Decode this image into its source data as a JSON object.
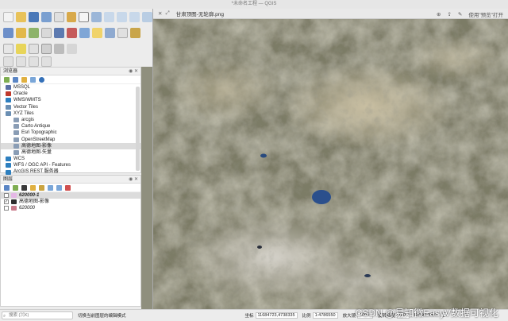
{
  "window": {
    "title": "*未命名工程 — QGIS"
  },
  "browser_panel": {
    "title": "浏览器",
    "items": [
      {
        "label": "MSSQL",
        "icon": "mssql-icon",
        "indent": 0,
        "color": "#5a6fa5"
      },
      {
        "label": "Oracle",
        "icon": "oracle-icon",
        "indent": 0,
        "color": "#c0392b"
      },
      {
        "label": "WMS/WMTS",
        "icon": "wms-icon",
        "indent": 0,
        "color": "#2d7fbf"
      },
      {
        "label": "Vector Tiles",
        "icon": "vector-tiles-icon",
        "indent": 0,
        "color": "#6b8fb3"
      },
      {
        "label": "XYZ Tiles",
        "icon": "xyz-tiles-icon",
        "indent": 0,
        "color": "#6b8fb3"
      },
      {
        "label": "arcgis",
        "icon": "tile-icon",
        "indent": 1,
        "color": "#8a9db5"
      },
      {
        "label": "Carto Antique",
        "icon": "tile-icon",
        "indent": 1,
        "color": "#8a9db5"
      },
      {
        "label": "Esri Topographic",
        "icon": "tile-icon",
        "indent": 1,
        "color": "#8a9db5"
      },
      {
        "label": "OpenStreetMap",
        "icon": "tile-icon",
        "indent": 1,
        "color": "#8a9db5"
      },
      {
        "label": "高德地图-影像",
        "icon": "tile-icon",
        "indent": 1,
        "color": "#8a9db5",
        "selected": true
      },
      {
        "label": "高德地图-矢量",
        "icon": "tile-icon",
        "indent": 1,
        "color": "#8a9db5"
      },
      {
        "label": "WCS",
        "icon": "wcs-icon",
        "indent": 0,
        "color": "#2d7fbf"
      },
      {
        "label": "WFS / OGC API - Features",
        "icon": "wfs-icon",
        "indent": 0,
        "color": "#2d7fbf"
      },
      {
        "label": "ArcGIS REST 服务器",
        "icon": "arcgis-rest-icon",
        "indent": 0,
        "color": "#2d7fbf"
      }
    ]
  },
  "layers_panel": {
    "title": "图层",
    "items": [
      {
        "label": "620000-1",
        "checked": false,
        "swatch": "#e5b8e6",
        "italic": true,
        "bold": true,
        "selected": true
      },
      {
        "label": "高德地图-影像",
        "checked": true,
        "swatch": "#2d2d2d",
        "italic": false,
        "bold": false,
        "selected": false
      },
      {
        "label": "620000",
        "checked": false,
        "swatch": "#c97a8a",
        "italic": true,
        "bold": false,
        "selected": false
      }
    ]
  },
  "statusbar": {
    "locator_placeholder": "搜索 (⌘K)",
    "message": "切换当前图层的编辑模式",
    "coord_label": "坐标",
    "coord_value": "11684723,4738335",
    "scale_label": "比例",
    "scale_value": "1:4786550",
    "magnifier_label": "放大镜",
    "magnifier_value": "100%",
    "rotation_label": "旋转角度",
    "rotation_value": "0.0°",
    "crs": "EPSG:3857"
  },
  "preview": {
    "title": "甘肃顶图-无轮廓.png",
    "open_with": "使用\"预览\"打开"
  },
  "watermark": "CSDN @易知微EasyV数据可视化",
  "colors": {
    "selection": "#dcdcdc",
    "lake": "#2b4f8c"
  }
}
